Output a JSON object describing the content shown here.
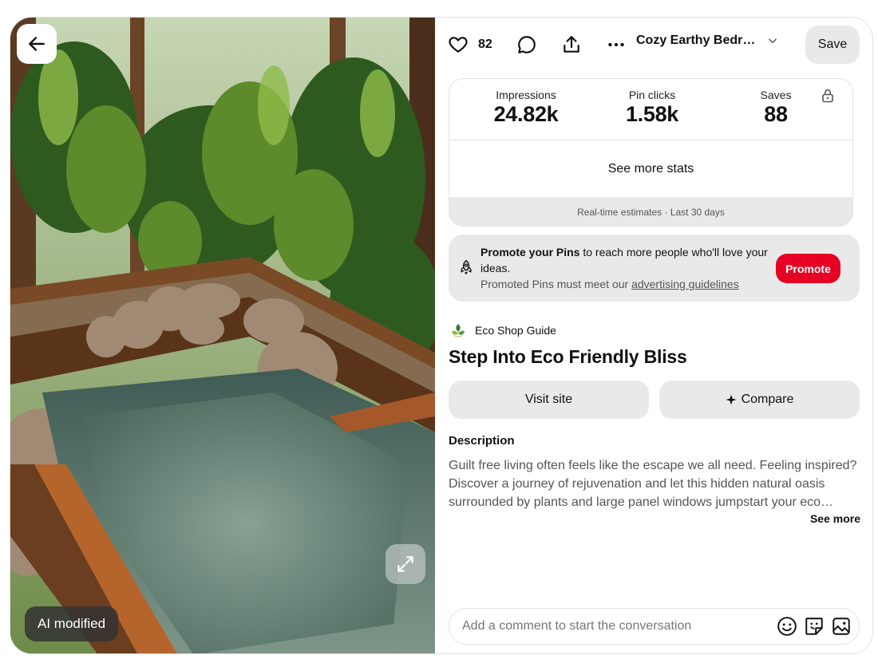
{
  "media": {
    "back_icon": "arrow-left-icon",
    "expand_icon": "expand-icon",
    "ai_badge": "AI modified"
  },
  "toolbar": {
    "like_icon": "heart-icon",
    "like_count": "82",
    "comment_icon": "comment-bubble-icon",
    "share_icon": "share-upload-icon",
    "more_icon": "ellipsis-icon",
    "board_name": "Cozy Earthy Bedroom",
    "board_chevron_icon": "chevron-down-icon",
    "save_label": "Save"
  },
  "stats": {
    "items": [
      {
        "label": "Impressions",
        "value": "24.82k"
      },
      {
        "label": "Pin clicks",
        "value": "1.58k"
      },
      {
        "label": "Saves",
        "value": "88"
      }
    ],
    "lock_icon": "lock-icon",
    "see_more": "See more stats",
    "footnote": "Real-time estimates · Last 30 days"
  },
  "promo": {
    "bold": "Promote your Pins",
    "text": " to reach more people who'll love your ideas.",
    "sub_prefix": "Promoted Pins must meet our ",
    "sub_link": "advertising guidelines",
    "button": "Promote",
    "icon": "rocket-icon"
  },
  "pin": {
    "creator": "Eco Shop Guide",
    "title": "Step Into Eco Friendly Bliss",
    "visit_label": "Visit site",
    "compare_label": "Compare",
    "compare_icon": "sparkle-icon",
    "description_heading": "Description",
    "description": "Guilt free living often feels like the escape we all need. Feeling inspired? Discover a journey of rejuvenation and let this hidden natural oasis surrounded by plants and large panel windows jumpstart your eco friendly lifestyle.",
    "see_more": "See more"
  },
  "comment": {
    "placeholder": "Add a comment to start the conversation",
    "icons": [
      "emoji-icon",
      "sticker-icon",
      "image-icon"
    ]
  },
  "colors": {
    "accent": "#e60023",
    "button_bg": "#e9e9e9",
    "border": "#e3e3e3",
    "muted_text": "#555555"
  }
}
